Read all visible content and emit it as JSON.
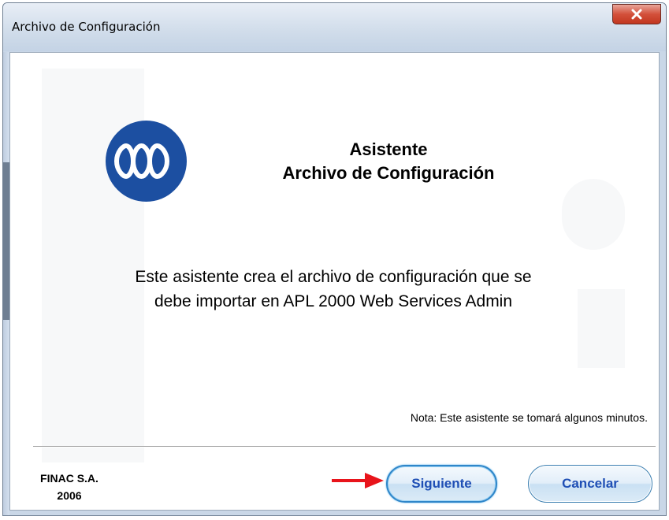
{
  "window": {
    "title": "Archivo de Configuración"
  },
  "header": {
    "title_line1": "Asistente",
    "title_line2": "Archivo de Configuración"
  },
  "description": {
    "line1": "Este asistente crea el archivo de configuración que se",
    "line2": "debe importar en APL 2000 Web Services Admin"
  },
  "note": "Nota: Este asistente se tomará algunos minutos.",
  "company": {
    "name": "FINAC S.A.",
    "year": "2006"
  },
  "buttons": {
    "next": "Siguiente",
    "cancel": "Cancelar"
  },
  "icons": {
    "logo": "finac-logo",
    "close": "close-icon",
    "pointer": "red-arrow-icon"
  },
  "colors": {
    "logo_blue": "#1c4fa1",
    "close_red": "#c9422b",
    "button_text": "#1f4fb5",
    "arrow_red": "#e8141b"
  }
}
